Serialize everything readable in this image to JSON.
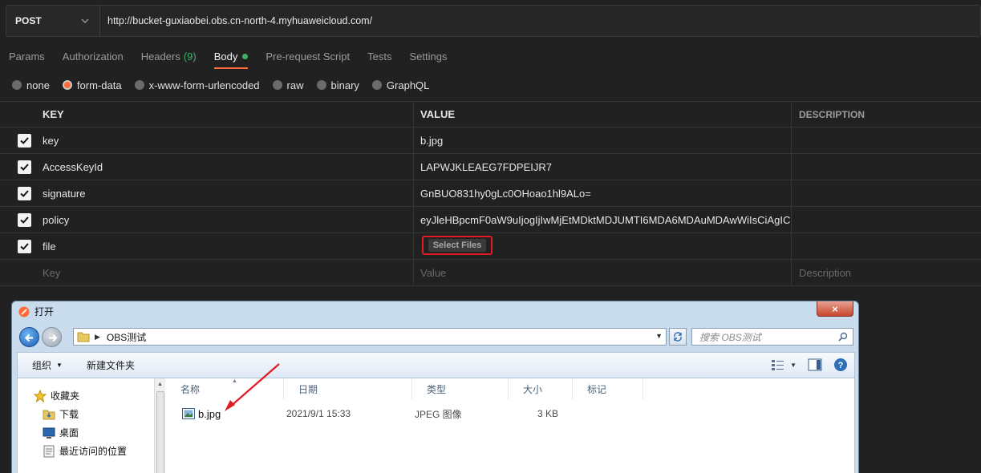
{
  "request": {
    "method": "POST",
    "url": "http://bucket-guxiaobei.obs.cn-north-4.myhuaweicloud.com/"
  },
  "tabs": [
    {
      "label": "Params"
    },
    {
      "label": "Authorization"
    },
    {
      "label": "Headers",
      "count": "(9)"
    },
    {
      "label": "Body",
      "active": true
    },
    {
      "label": "Pre-request Script"
    },
    {
      "label": "Tests"
    },
    {
      "label": "Settings"
    }
  ],
  "body_types": [
    {
      "label": "none"
    },
    {
      "label": "form-data",
      "selected": true
    },
    {
      "label": "x-www-form-urlencoded"
    },
    {
      "label": "raw"
    },
    {
      "label": "binary"
    },
    {
      "label": "GraphQL"
    }
  ],
  "table": {
    "headers": {
      "key": "KEY",
      "value": "VALUE",
      "description": "DESCRIPTION"
    },
    "rows": [
      {
        "key": "key",
        "value": "b.jpg"
      },
      {
        "key": "AccessKeyId",
        "value": "LAPWJKLEAEG7FDPEIJR7"
      },
      {
        "key": "signature",
        "value": "GnBUO831hy0gLc0OHoao1hl9ALo="
      },
      {
        "key": "policy",
        "value": "eyJleHBpcmF0aW9uIjogIjIwMjEtMDktMDJUMTI6MDA6MDAuMDAwWiIsCiAgIC..."
      },
      {
        "key": "file",
        "value": ""
      }
    ],
    "select_files_label": "Select Files",
    "placeholders": {
      "key": "Key",
      "value": "Value",
      "description": "Description"
    }
  },
  "dialog": {
    "title": "打开",
    "close_label": "×",
    "path": "OBS测试",
    "search_placeholder": "搜索 OBS测试",
    "toolbar": {
      "organize": "组织",
      "new_folder": "新建文件夹"
    },
    "sidebar": [
      {
        "label": "收藏夹"
      },
      {
        "label": "下载"
      },
      {
        "label": "桌面"
      },
      {
        "label": "最近访问的位置"
      }
    ],
    "columns": [
      "名称",
      "日期",
      "类型",
      "大小",
      "标记"
    ],
    "files": [
      {
        "name": "b.jpg",
        "date": "2021/9/1 15:33",
        "type": "JPEG 图像",
        "size": "3 KB"
      }
    ]
  },
  "colors": {
    "accent": "#ff6c37",
    "success": "#3fb068",
    "highlight_border": "#e01b24"
  }
}
